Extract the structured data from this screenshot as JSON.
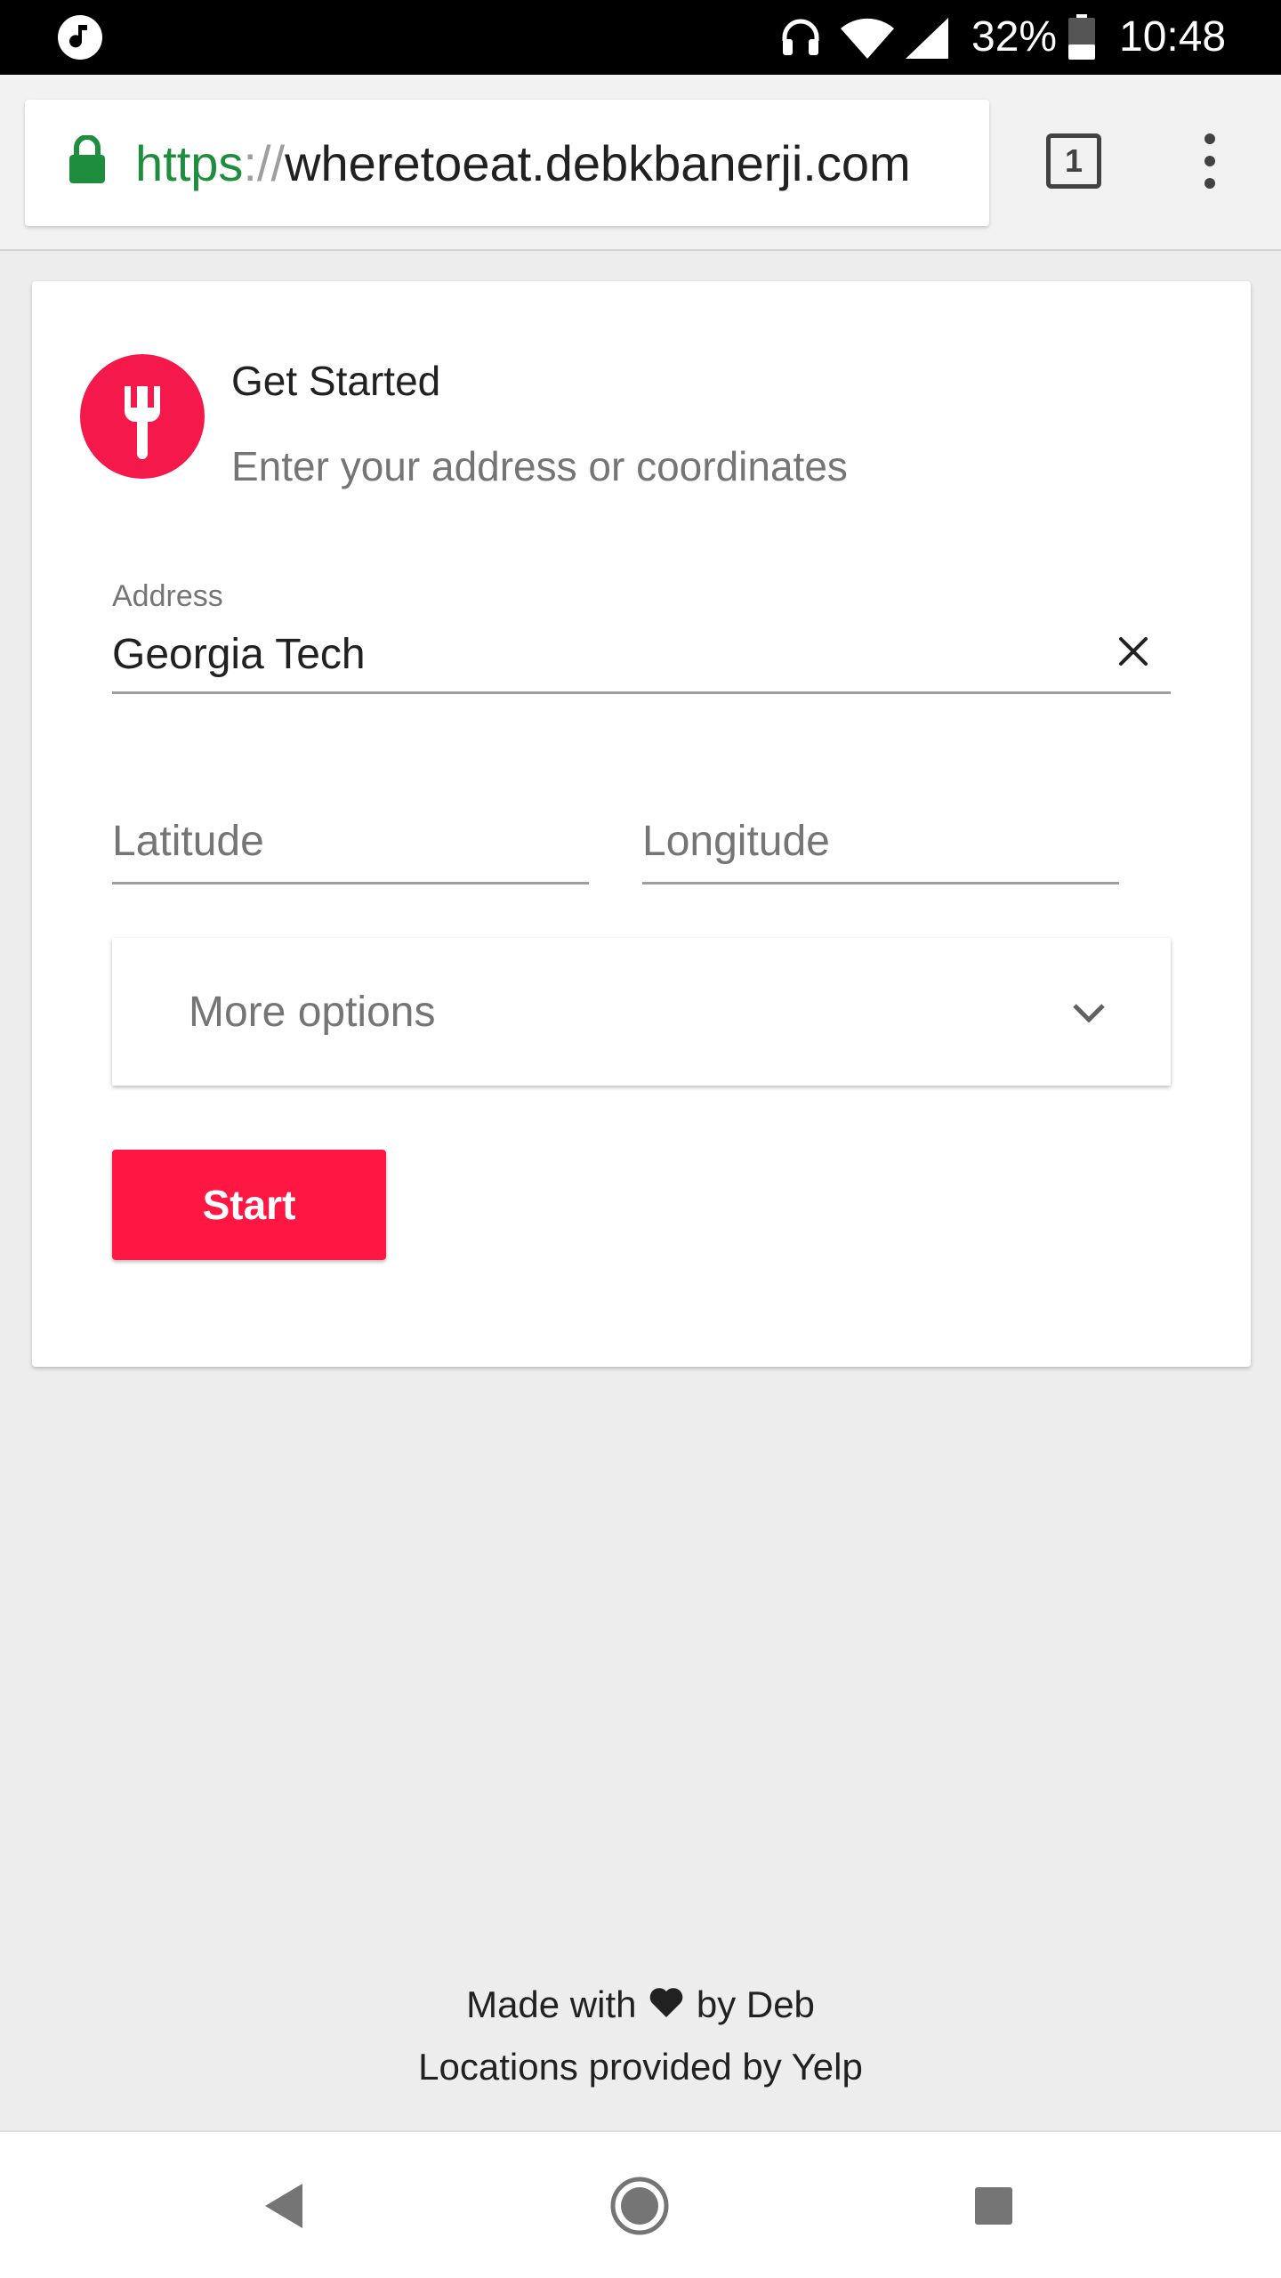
{
  "status_bar": {
    "battery_percent": "32%",
    "time": "10:48",
    "icons": [
      "music-note-icon",
      "headset-icon",
      "wifi-icon",
      "signal-icon",
      "battery-icon"
    ]
  },
  "browser": {
    "url_scheme": "https",
    "url_separator": "://",
    "url_host": "wheretoeat.debkbanerji.com",
    "tab_count": "1",
    "secure_color": "#1e8e3e"
  },
  "card": {
    "title": "Get Started",
    "subtitle": "Enter your address or coordinates",
    "logo_color": "#f4184b",
    "address": {
      "label": "Address",
      "value": "Georgia Tech"
    },
    "latitude": {
      "placeholder": "Latitude"
    },
    "longitude": {
      "placeholder": "Longitude"
    },
    "more_options_label": "More options",
    "start_label": "Start",
    "accent": "#ff1744"
  },
  "footer": {
    "made_with": "Made with",
    "by": "by Deb",
    "locations": "Locations provided by Yelp"
  }
}
